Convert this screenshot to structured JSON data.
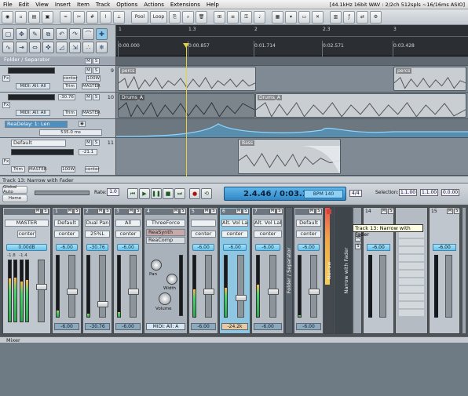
{
  "menu": {
    "items": [
      "File",
      "Edit",
      "View",
      "Insert",
      "Item",
      "Track",
      "Options",
      "Actions",
      "Extensions",
      "Help"
    ],
    "status": "[44.1kHz 16bit WAV : 2/2ch 512spls ~16/16ms ASIO]"
  },
  "toolbar": {
    "pool_label": "Pool",
    "loop_label": "Loop"
  },
  "ruler": {
    "bars": [
      "1",
      "1.3",
      "2",
      "2.3",
      "3"
    ],
    "times": [
      "0:00.000",
      "0:00.857",
      "0:01.714",
      "0:02.571",
      "0:03.428"
    ]
  },
  "tracks": [
    {
      "name": "Folder / Separator",
      "num": "9"
    },
    {
      "name": "",
      "num": "9",
      "pan": "center",
      "vol": "100W",
      "route": "MIDI: All: All",
      "trim": "Trim",
      "master": "MASTER"
    },
    {
      "name": "",
      "num": "10",
      "vol": "-30.76",
      "route": "MIDI: All: All",
      "trim": "Trim",
      "master": "MASTER"
    },
    {
      "name": "ReaDelay: 1: Len",
      "num": "",
      "val": "535.0 ms"
    },
    {
      "name": "Default",
      "num": "11",
      "vol": "-21.1",
      "trim": "Trim",
      "master": "MASTER",
      "pan": "center",
      "vol2": "100W"
    }
  ],
  "items": {
    "perc1": "percs",
    "perc2": "percs",
    "drums1": "Drums_A",
    "drums2": "Drums_A",
    "bass": "Bass"
  },
  "tracks_footer": "Track 13: Narrow with Fader",
  "transport": {
    "global_auto": "Global Auto",
    "home": "Home",
    "rate_label": "Rate:",
    "rate": "1.0",
    "time": "2.4.46 / 0:03.197",
    "bpm": "BPM   140",
    "sig": "4/4",
    "selection_label": "Selection:",
    "sel_start": "1.1.00",
    "sel_end": "1.1.00",
    "sel_len": "0.0.00"
  },
  "mixer": {
    "master": {
      "hdr": "",
      "name": "MASTER",
      "pan": "center",
      "vol": "0.00dB",
      "left_peak": "-1.8",
      "right_peak": "-1.4"
    },
    "strips": [
      {
        "num": "1",
        "name": "Default",
        "pan": "center",
        "vol": "-6.00",
        "ftr": "-6.00"
      },
      {
        "num": "2",
        "name": "Dual Pan",
        "pan": "25%L",
        "vol": "-30.76",
        "ftr": "-30.76"
      },
      {
        "num": "3",
        "name": "All",
        "pan": "center",
        "vol": "-6.00",
        "ftr": "-6.00"
      },
      {
        "num": "4",
        "name": "ThreeForce",
        "pan": "",
        "vol": "",
        "ftr": "MIDI: All: A"
      },
      {
        "num": "5",
        "name": "",
        "pan": "center",
        "vol": "-6.00",
        "ftr": "-6.00"
      },
      {
        "num": "6",
        "name": "Alt. Vol Label",
        "pan": "center",
        "vol": "-6.00",
        "ftr": "-24.2k"
      },
      {
        "num": "7",
        "name": "Alt. Vol Label",
        "pan": "center",
        "vol": "-6.00",
        "ftr": "-6.00"
      },
      {
        "num": "",
        "name": "Default",
        "pan": "center",
        "vol": "-6.00",
        "ftr": "-6.00"
      }
    ],
    "fx": {
      "reasynth": "ReaSynth",
      "reacomp": "ReaComp",
      "pan": "Pan",
      "width": "Width",
      "vol": "Volume"
    },
    "vertical": {
      "folder": "Folder / Separator",
      "narrow": "Narrow",
      "narrow_fader": "Narrow with Fader"
    },
    "right_strips": [
      {
        "num": "14",
        "vol": "-6.00"
      },
      {
        "num": "15",
        "vol": "-6.00"
      }
    ],
    "tab": "Mixer"
  },
  "tooltip": "Track 13: Narrow with Fader"
}
